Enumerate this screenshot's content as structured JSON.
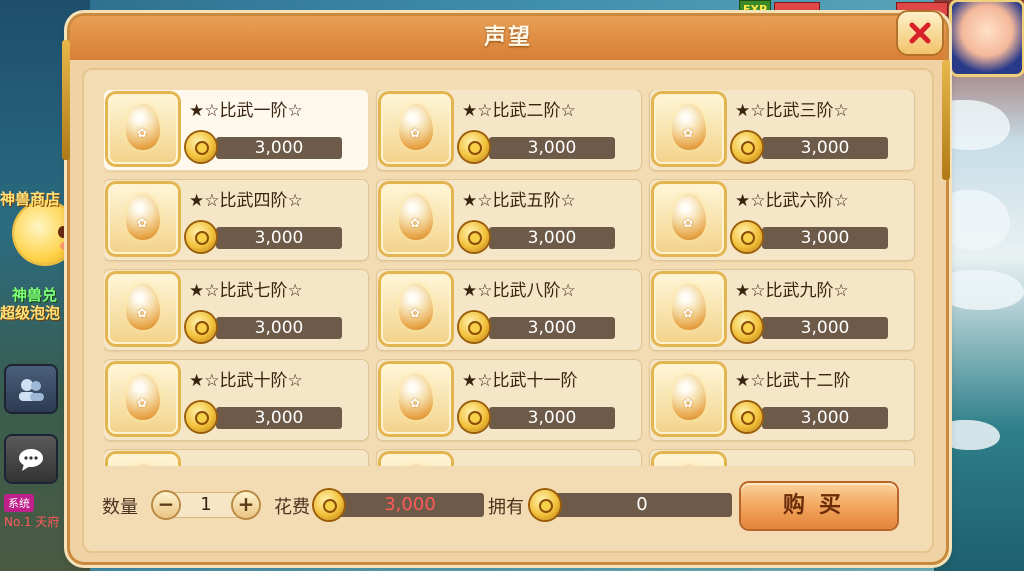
{
  "dialog": {
    "title": "声望"
  },
  "items": [
    {
      "name": "★☆比武一阶☆",
      "price": "3,000",
      "selected": true
    },
    {
      "name": "★☆比武二阶☆",
      "price": "3,000"
    },
    {
      "name": "★☆比武三阶☆",
      "price": "3,000"
    },
    {
      "name": "★☆比武四阶☆",
      "price": "3,000"
    },
    {
      "name": "★☆比武五阶☆",
      "price": "3,000"
    },
    {
      "name": "★☆比武六阶☆",
      "price": "3,000"
    },
    {
      "name": "★☆比武七阶☆",
      "price": "3,000"
    },
    {
      "name": "★☆比武八阶☆",
      "price": "3,000"
    },
    {
      "name": "★☆比武九阶☆",
      "price": "3,000"
    },
    {
      "name": "★☆比武十阶☆",
      "price": "3,000"
    },
    {
      "name": "★☆比武十一阶",
      "price": "3,000"
    },
    {
      "name": "★☆比武十二阶",
      "price": "3,000"
    },
    {
      "name": "",
      "price": ""
    },
    {
      "name": "",
      "price": ""
    },
    {
      "name": "",
      "price": ""
    }
  ],
  "footer": {
    "quantity_label": "数量",
    "quantity_value": "1",
    "cost_label": "花费",
    "cost_value": "3,000",
    "owned_label": "拥有",
    "owned_value": "0",
    "buy_label": "购买",
    "cost_color": "#ff5a5a"
  },
  "background": {
    "left_label_1": "神兽商店",
    "left_label_2": "神兽兑",
    "left_label_3": "超级泡泡",
    "system_tag": "系统",
    "system_line": "No.1 天府",
    "exp_badge": "EXP"
  },
  "icons": {
    "coin": "coin-icon",
    "egg": "egg-icon",
    "close": "close-icon",
    "minus": "minus-icon",
    "plus": "plus-icon"
  }
}
